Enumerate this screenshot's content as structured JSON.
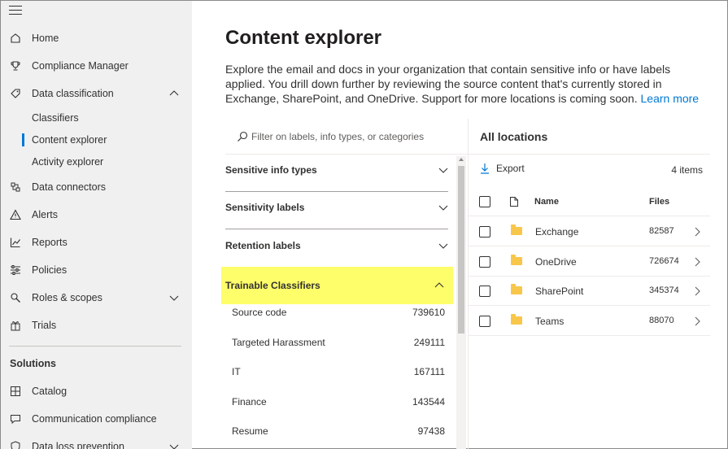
{
  "sidebar": {
    "items": [
      {
        "label": "Home",
        "icon": "home-icon"
      },
      {
        "label": "Compliance Manager",
        "icon": "trophy-icon"
      },
      {
        "label": "Data classification",
        "icon": "tag-icon"
      },
      {
        "label": "Data connectors",
        "icon": "connector-icon"
      },
      {
        "label": "Alerts",
        "icon": "alert-icon"
      },
      {
        "label": "Reports",
        "icon": "chart-icon"
      },
      {
        "label": "Policies",
        "icon": "sliders-icon"
      },
      {
        "label": "Roles & scopes",
        "icon": "roles-icon"
      },
      {
        "label": "Trials",
        "icon": "gift-icon"
      }
    ],
    "sub_items": [
      "Classifiers",
      "Content explorer",
      "Activity explorer"
    ],
    "solutions_title": "Solutions",
    "solutions": [
      {
        "label": "Catalog",
        "icon": "catalog-icon"
      },
      {
        "label": "Communication compliance",
        "icon": "chat-icon"
      },
      {
        "label": "Data loss prevention",
        "icon": "shield-icon"
      }
    ]
  },
  "main": {
    "title": "Content explorer",
    "description": "Explore the email and docs in your organization that contain sensitive info or have labels applied. You drill down further by reviewing the source content that's currently stored in Exchange, SharePoint, and OneDrive. Support for more locations is coming soon. ",
    "learn_more": "Learn more"
  },
  "filter": {
    "placeholder": "Filter on labels, info types, or categories",
    "sections": [
      "Sensitive info types",
      "Sensitivity labels",
      "Retention labels",
      "Trainable Classifiers"
    ],
    "highlight_color": "#fefd6a",
    "classifiers": [
      {
        "label": "Source code",
        "count": "739610"
      },
      {
        "label": "Targeted Harassment",
        "count": "249111"
      },
      {
        "label": "IT",
        "count": "167111"
      },
      {
        "label": "Finance",
        "count": "143544"
      },
      {
        "label": "Resume",
        "count": "97438"
      }
    ]
  },
  "locations": {
    "title": "All locations",
    "export_label": "Export",
    "items_count": "4 items",
    "headers": {
      "name": "Name",
      "files": "Files"
    },
    "rows": [
      {
        "name": "Exchange",
        "files": "82587"
      },
      {
        "name": "OneDrive",
        "files": "726674"
      },
      {
        "name": "SharePoint",
        "files": "345374"
      },
      {
        "name": "Teams",
        "files": "88070"
      }
    ]
  }
}
